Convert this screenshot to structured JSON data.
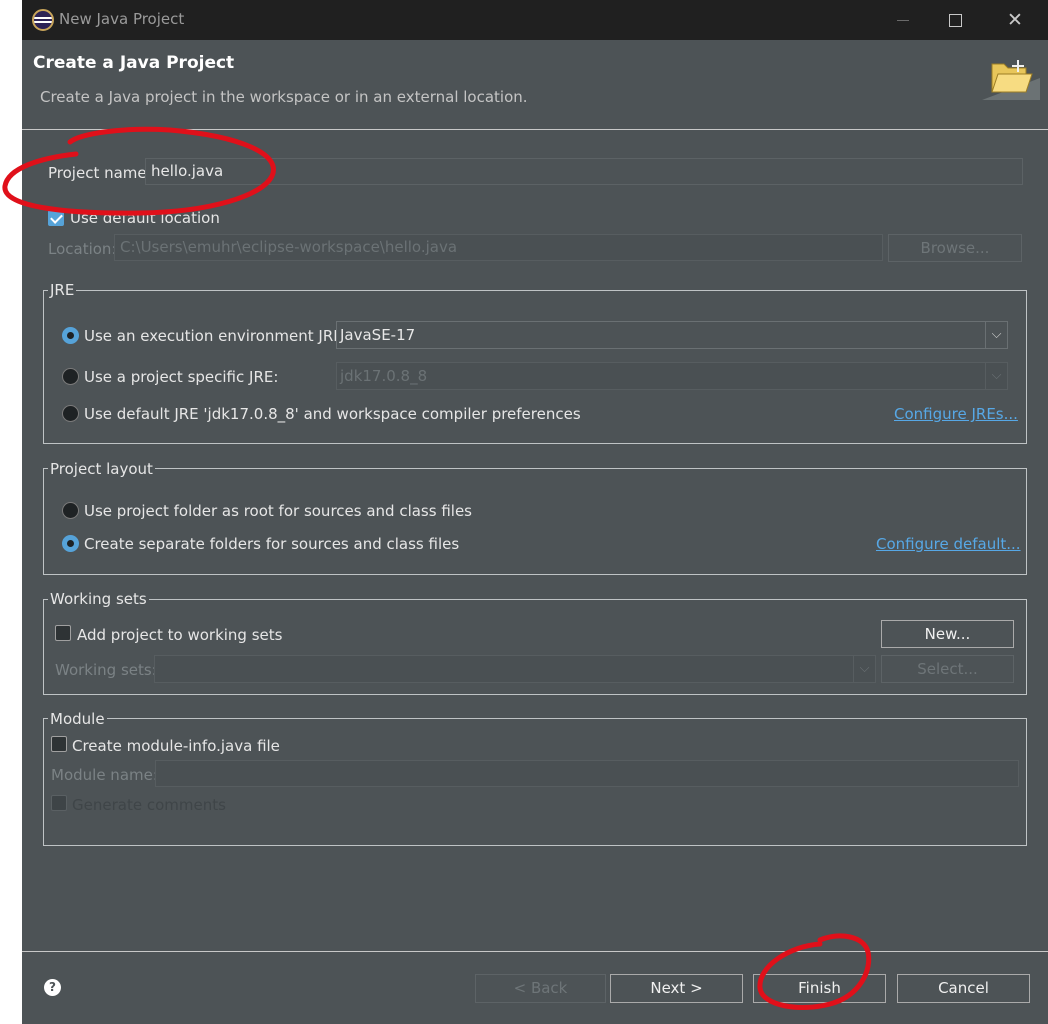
{
  "window": {
    "title": "New Java Project"
  },
  "header": {
    "title": "Create a Java Project",
    "description": "Create a Java project in the workspace or in an external location."
  },
  "project": {
    "name_label": "Project name:",
    "name_value": "hello.java",
    "use_default_location_label": "Use default location",
    "use_default_location_checked": true,
    "location_label": "Location:",
    "location_value": "C:\\Users\\emuhr\\eclipse-workspace\\hello.java",
    "browse_label": "Browse..."
  },
  "jre": {
    "group_title": "JRE",
    "option_env_label": "Use an execution environment JRE:",
    "option_env_value": "JavaSE-17",
    "option_specific_label": "Use a project specific JRE:",
    "option_specific_value": "jdk17.0.8_8",
    "option_default_label": "Use default JRE 'jdk17.0.8_8' and workspace compiler preferences",
    "configure_link": "Configure JREs...",
    "selected": "execution environment"
  },
  "layout": {
    "group_title": "Project layout",
    "option_root_label": "Use project folder as root for sources and class files",
    "option_separate_label": "Create separate folders for sources and class files",
    "configure_link": "Configure default...",
    "selected": "separate folders"
  },
  "working_sets": {
    "group_title": "Working sets",
    "add_label": "Add project to working sets",
    "add_checked": false,
    "new_button": "New...",
    "sets_label": "Working sets:",
    "select_button": "Select..."
  },
  "module": {
    "group_title": "Module",
    "create_label": "Create module-info.java file",
    "create_checked": false,
    "name_label": "Module name:",
    "generate_label": "Generate comments"
  },
  "footer": {
    "help": "?",
    "back_label": "< Back",
    "next_label": "Next >",
    "finish_label": "Finish",
    "cancel_label": "Cancel"
  },
  "colors": {
    "background": "#4d5356",
    "titlebar": "#202020",
    "accent": "#56a3d9",
    "link": "#57a8e6",
    "annotation": "#e0101a"
  }
}
